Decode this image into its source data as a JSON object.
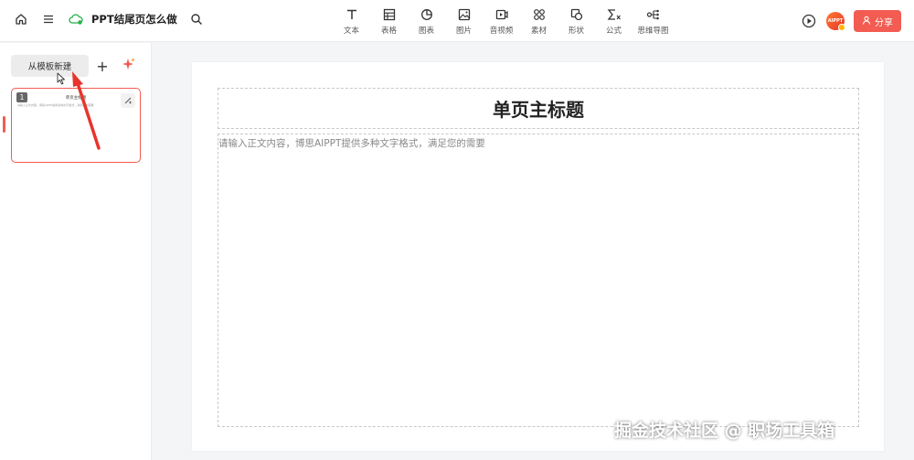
{
  "header": {
    "doc_title": "PPT结尾页怎么做",
    "tools": [
      {
        "label": "文本",
        "icon": "text-icon"
      },
      {
        "label": "表格",
        "icon": "table-icon"
      },
      {
        "label": "图表",
        "icon": "chart-icon"
      },
      {
        "label": "图片",
        "icon": "image-icon"
      },
      {
        "label": "音视频",
        "icon": "video-icon"
      },
      {
        "label": "素材",
        "icon": "assets-icon"
      },
      {
        "label": "形状",
        "icon": "shape-icon"
      },
      {
        "label": "公式",
        "icon": "formula-icon"
      },
      {
        "label": "思维导图",
        "icon": "mindmap-icon"
      }
    ],
    "avatar_text": "AIPPT",
    "share_label": "分享"
  },
  "sidebar": {
    "new_from_template": "从模板新建",
    "add_symbol": "+",
    "slides": [
      {
        "number": "1",
        "title": "单页主标题",
        "body": "请输入正文内容，博思AIPPT提供多种文字格式，满足您的需要"
      }
    ]
  },
  "canvas": {
    "title": "单页主标题",
    "body": "请输入正文内容，博思AIPPT提供多种文字格式，满足您的需要"
  },
  "watermark": "掘金技术社区 @ 职场工具箱",
  "colors": {
    "accent": "#f25c52"
  }
}
